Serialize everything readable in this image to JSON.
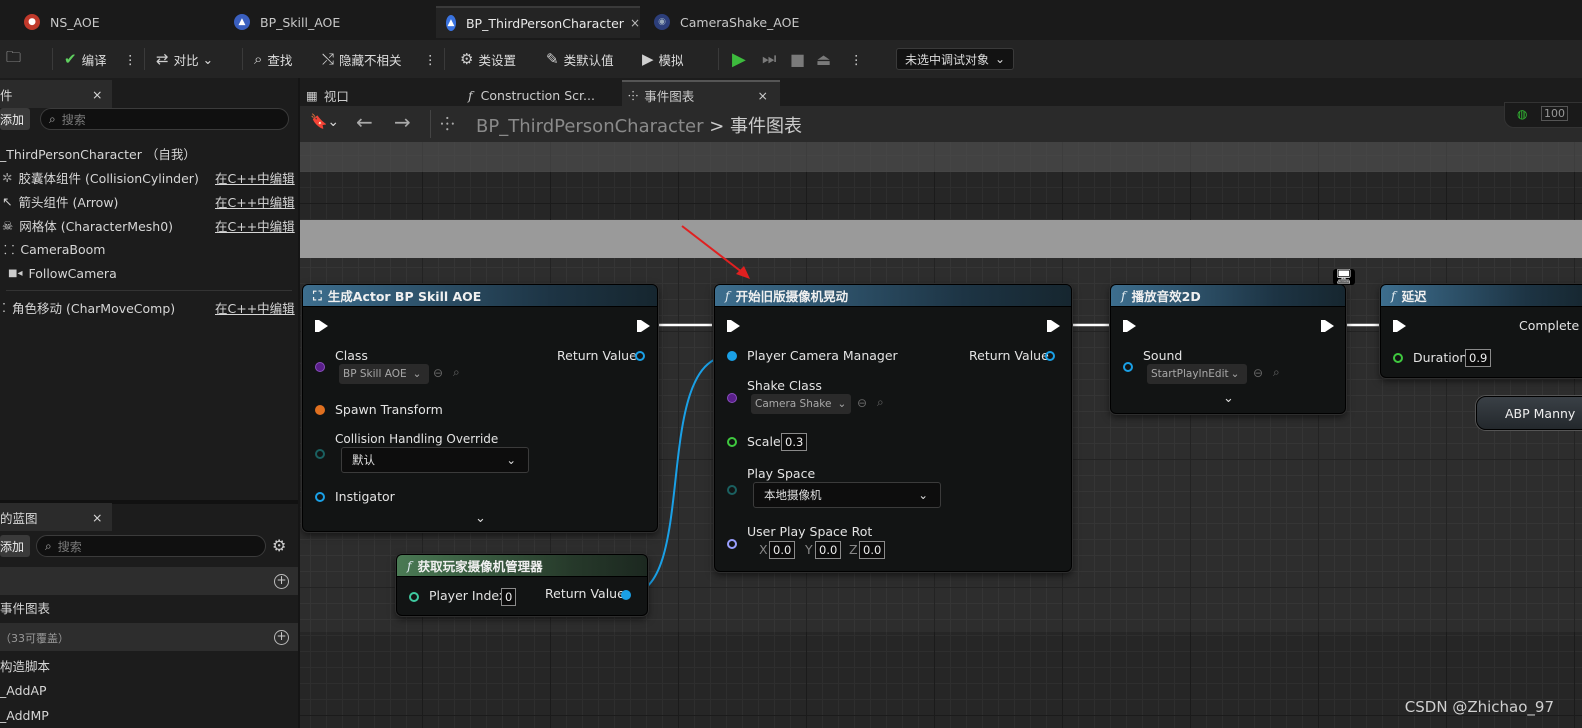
{
  "doc_tabs": [
    {
      "label": "NS_AOE",
      "icon": "niagara-icon",
      "color": "#c0392b"
    },
    {
      "label": "BP_Skill_AOE",
      "icon": "blueprint-actor-icon",
      "color": "#3a5fbf"
    },
    {
      "label": "BP_ThirdPersonCharacter",
      "icon": "blueprint-character-icon",
      "color": "#3a73e0",
      "close": "×"
    },
    {
      "label": "CameraShake_AOE",
      "icon": "camera-shake-icon",
      "color": "#3a5fbf"
    }
  ],
  "toolbar": {
    "compile": "编译",
    "diff": "对比",
    "find": "查找",
    "hide_unrelated": "隐藏不相关",
    "class_settings": "类设置",
    "class_defaults": "类默认值",
    "simulate": "模拟",
    "debug_object": "未选中调试对象"
  },
  "components_panel": {
    "tab_title": "件",
    "close": "×",
    "add_label": "添加",
    "search_placeholder": "搜索",
    "items": [
      {
        "label": "_ThirdPersonCharacter （自我）",
        "edit": ""
      },
      {
        "label": "胶囊体组件 (CollisionCylinder)",
        "edit": "在C++中编辑"
      },
      {
        "label": "箭头组件 (Arrow)",
        "edit": "在C++中编辑"
      },
      {
        "label": "网格体 (CharacterMesh0)",
        "edit": "在C++中编辑"
      },
      {
        "label": "CameraBoom",
        "edit": ""
      },
      {
        "label": "FollowCamera",
        "edit": ""
      },
      {
        "label": "角色移动 (CharMoveComp)",
        "edit": "在C++中编辑"
      }
    ]
  },
  "my_blueprint_panel": {
    "tab_title": "的蓝图",
    "close": "×",
    "add_label": "添加",
    "search_placeholder": "搜索",
    "event_graph": "事件图表",
    "overridable": "（33可覆盖）",
    "construction_script": "构造脚本",
    "functions": [
      "_AddAP",
      "_AddMP"
    ]
  },
  "graph_tabs": [
    {
      "label": "视口",
      "icon": "viewport-icon"
    },
    {
      "label": "Construction Scr...",
      "icon": "function-icon"
    },
    {
      "label": "事件图表",
      "icon": "event-graph-icon",
      "close": "×"
    }
  ],
  "breadcrumb": {
    "blueprint": "BP_ThirdPersonCharacter",
    "separator": ">",
    "graph": "事件图表"
  },
  "zoom_partial": "100",
  "nodes": {
    "spawn_actor": {
      "title": "生成Actor BP Skill AOE",
      "class_label": "Class",
      "class_value": "BP Skill AOE",
      "return_label": "Return Value",
      "spawn_transform": "Spawn Transform",
      "collision_label": "Collision Handling Override",
      "collision_value": "默认",
      "instigator": "Instigator"
    },
    "camera_shake": {
      "title": "开始旧版摄像机晃动",
      "pcm": "Player Camera Manager",
      "return_label": "Return Value",
      "shake_class_label": "Shake Class",
      "shake_class_value": "Camera Shake",
      "scale_label": "Scale",
      "scale_value": "0.3",
      "play_space_label": "Play Space",
      "play_space_value": "本地摄像机",
      "rot_label": "User Play Space Rot",
      "x": "X",
      "x_val": "0.0",
      "y": "Y",
      "y_val": "0.0",
      "z": "Z",
      "z_val": "0.0"
    },
    "play_sound": {
      "title": "播放音效2D",
      "sound_label": "Sound",
      "sound_value": "StartPlayInEdit"
    },
    "delay": {
      "title": "延迟",
      "completed": "Complete",
      "duration_label": "Duration",
      "duration_value": "0.9"
    },
    "get_pcm": {
      "title": "获取玩家摄像机管理器",
      "index_label": "Player Index",
      "index_value": "0",
      "return_label": "Return Value"
    },
    "abp": {
      "label": "ABP Manny"
    }
  },
  "watermark": "CSDN @Zhichao_97"
}
